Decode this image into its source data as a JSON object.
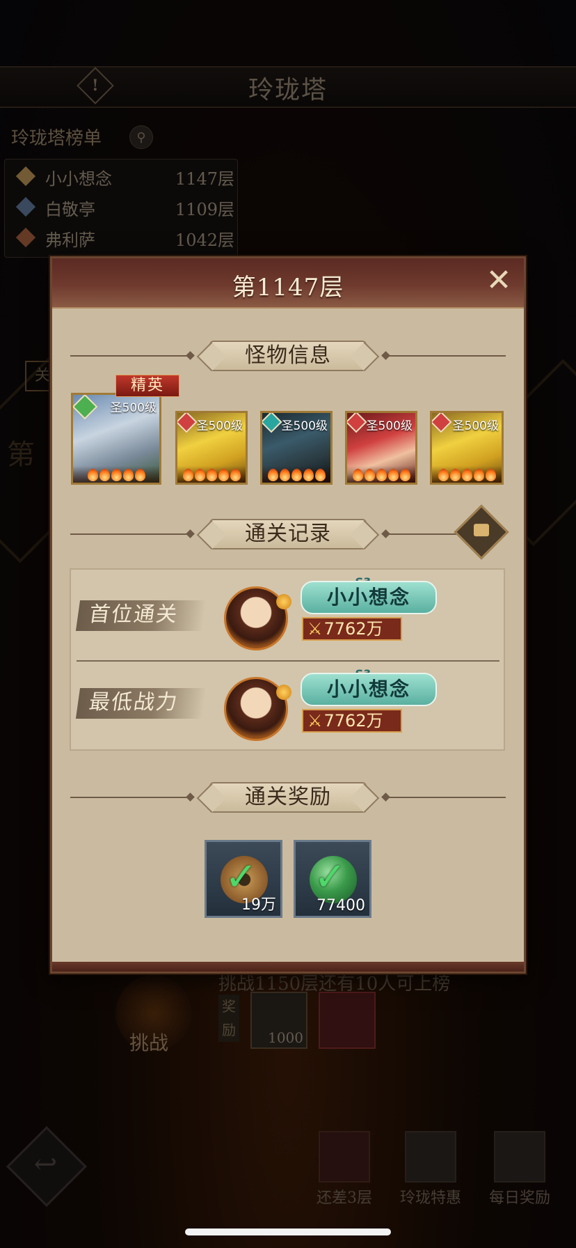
{
  "background": {
    "title": "玲珑塔",
    "leaderboard": {
      "title": "玲珑塔榜单",
      "rows": [
        {
          "rank": "1",
          "name": "小小想念",
          "floor": "1147层",
          "color": "#b08a50"
        },
        {
          "rank": "2",
          "name": "白敬亭",
          "floor": "1109层",
          "color": "#5a7090"
        },
        {
          "rank": "3",
          "name": "弗利萨",
          "floor": "1042层",
          "color": "#9a5a3a"
        }
      ]
    },
    "side_tab": "关",
    "side_big": "第",
    "challenge_hint": "挑战1150层还有10人可上榜",
    "challenge_label": "挑战",
    "reward_label": "奖励",
    "reward_item_value": "1000",
    "bottom_buttons": [
      {
        "label": "还差3层"
      },
      {
        "label": "玲珑特惠"
      },
      {
        "label": "每日奖励"
      }
    ]
  },
  "modal": {
    "title": "第1147层",
    "sections": {
      "monster_info": "怪物信息",
      "clear_record": "通关记录",
      "clear_reward": "通关奖励"
    },
    "elite_tag": "精英",
    "monsters": [
      {
        "level": "圣500级",
        "element_color": "#4caf50"
      },
      {
        "level": "圣500级",
        "element_color": "#d04040"
      },
      {
        "level": "圣500级",
        "element_color": "#2aa6a0"
      },
      {
        "level": "圣500级",
        "element_color": "#d04040"
      },
      {
        "level": "圣500级",
        "element_color": "#d04040"
      }
    ],
    "records": [
      {
        "label": "首位通关",
        "season": "S3",
        "name": "小小想念",
        "power": "7762万"
      },
      {
        "label": "最低战力",
        "season": "S3",
        "name": "小小想念",
        "power": "7762万"
      }
    ],
    "rewards": [
      {
        "icon": "copper-coin",
        "value": "19万"
      },
      {
        "icon": "jade-orb",
        "value": "77400"
      }
    ]
  }
}
